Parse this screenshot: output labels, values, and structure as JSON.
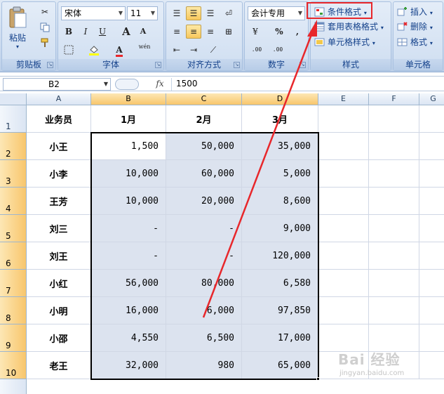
{
  "ribbon": {
    "clipboard": {
      "label": "剪贴板",
      "paste_label": "粘贴"
    },
    "font": {
      "label": "字体",
      "font_name": "宋体",
      "font_size": "11",
      "bold": "B",
      "italic": "I",
      "underline": "U",
      "grow": "A",
      "shrink": "A",
      "phonetic": "wén"
    },
    "alignment": {
      "label": "对齐方式"
    },
    "number": {
      "label": "数字",
      "format": "会计专用",
      "percent": "%",
      "comma": ",",
      "inc_decimal": ".00",
      "dec_decimal": ".00"
    },
    "styles": {
      "label": "样式",
      "conditional": "条件格式",
      "table_format": "套用表格格式",
      "cell_styles": "单元格样式"
    },
    "cells": {
      "label": "单元格",
      "insert": "插入",
      "delete": "删除",
      "format": "格式"
    }
  },
  "formula_bar": {
    "name_box": "B2",
    "fx": "fx",
    "value": "1500"
  },
  "columns": [
    "A",
    "B",
    "C",
    "D",
    "E",
    "F",
    "G"
  ],
  "header_row": {
    "row": "1",
    "a": "业务员",
    "b": "1月",
    "c": "2月",
    "d": "3月"
  },
  "rows": [
    {
      "row": "2",
      "name": "小王",
      "b": "1,500",
      "c": "50,000",
      "d": "35,000"
    },
    {
      "row": "3",
      "name": "小李",
      "b": "10,000",
      "c": "60,000",
      "d": "5,000"
    },
    {
      "row": "4",
      "name": "王芳",
      "b": "10,000",
      "c": "20,000",
      "d": "8,600"
    },
    {
      "row": "5",
      "name": "刘三",
      "b": "-",
      "c": "-",
      "d": "9,000"
    },
    {
      "row": "6",
      "name": "刘王",
      "b": "-",
      "c": "-",
      "d": "120,000"
    },
    {
      "row": "7",
      "name": "小红",
      "b": "56,000",
      "c": "80,000",
      "d": "6,580"
    },
    {
      "row": "8",
      "name": "小明",
      "b": "16,000",
      "c": "6,000",
      "d": "97,850"
    },
    {
      "row": "9",
      "name": "小邵",
      "b": "4,550",
      "c": "6,500",
      "d": "17,000"
    },
    {
      "row": "10",
      "name": "老王",
      "b": "32,000",
      "c": "980",
      "d": "65,000"
    }
  ],
  "watermark": {
    "logo": "Bai 经验",
    "url": "jingyan.baidu.com"
  },
  "colors": {
    "annotation": "#e8272b",
    "selection_fill": "#dce3ef"
  }
}
